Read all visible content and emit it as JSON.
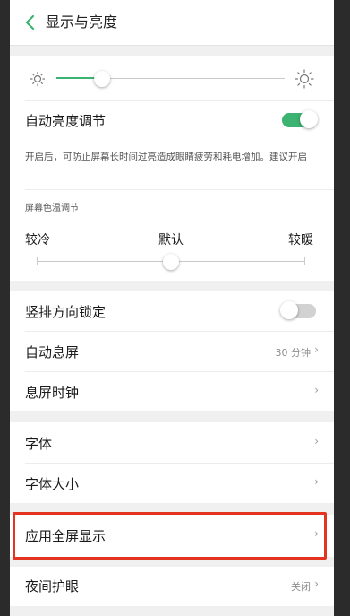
{
  "header": {
    "title": "显示与亮度"
  },
  "brightness": {
    "level": 0.2,
    "auto_label": "自动亮度调节",
    "auto_on": true,
    "hint": "开启后，可防止屏幕长时间过亮造成眼睛疲劳和耗电增加。建议开启"
  },
  "color_temp": {
    "section_label": "屏幕色温调节",
    "cool_label": "较冷",
    "default_label": "默认",
    "warm_label": "较暖",
    "level": 0.5
  },
  "group2": {
    "rotation_lock_label": "竖排方向锁定",
    "rotation_lock_on": false,
    "screen_timeout_label": "自动息屏",
    "screen_timeout_value": "30 分钟",
    "clock_label": "息屏时钟"
  },
  "group3": {
    "font_label": "字体",
    "font_size_label": "字体大小"
  },
  "group4": {
    "fullscreen_label": "应用全屏显示"
  },
  "group5": {
    "night_label": "夜间护眼",
    "night_value": "关闭"
  },
  "chevron": "›",
  "colors": {
    "accent": "#3cb371",
    "highlight": "#e53322"
  }
}
